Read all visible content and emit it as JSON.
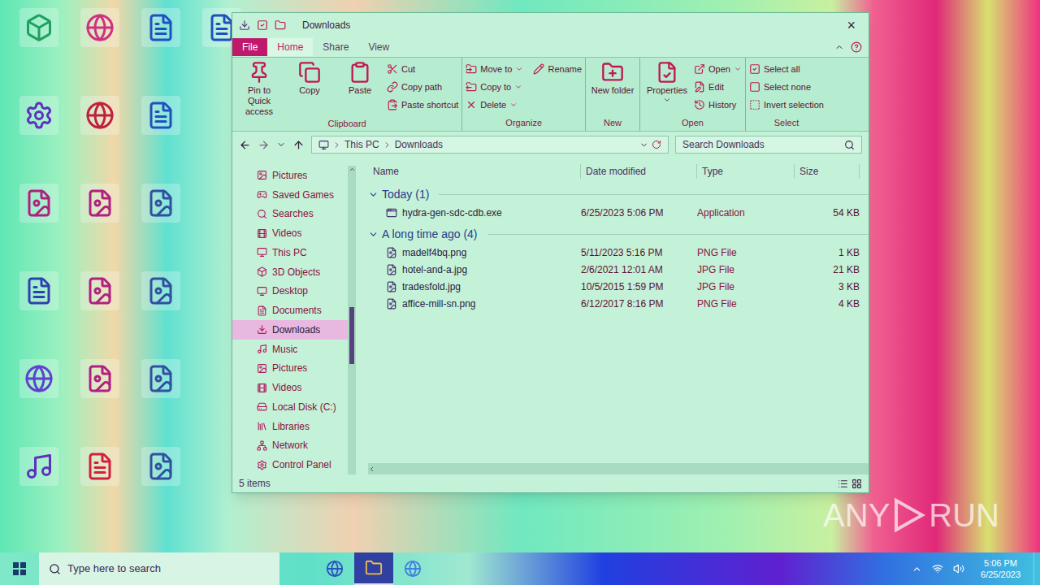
{
  "window": {
    "title": "Downloads",
    "close": "×"
  },
  "ribbon_tabs": [
    {
      "label": "File",
      "kind": "file",
      "selected": false
    },
    {
      "label": "Home",
      "kind": "tab",
      "selected": true
    },
    {
      "label": "Share",
      "kind": "tab",
      "selected": false
    },
    {
      "label": "View",
      "kind": "tab",
      "selected": false
    }
  ],
  "ribbon_groups": [
    {
      "label": "Clipboard",
      "items": [
        {
          "label": "Pin to Quick access",
          "kind": "large",
          "dropdown": false
        },
        {
          "label": "Copy",
          "kind": "large",
          "dropdown": false
        },
        {
          "label": "Paste",
          "kind": "large",
          "dropdown": false
        },
        {
          "label": "Cut",
          "kind": "small",
          "dropdown": false
        },
        {
          "label": "Copy path",
          "kind": "small",
          "dropdown": false
        },
        {
          "label": "Paste shortcut",
          "kind": "small",
          "dropdown": false
        }
      ]
    },
    {
      "label": "Organize",
      "items": [
        {
          "label": "Move to",
          "kind": "small",
          "dropdown": true
        },
        {
          "label": "Copy to",
          "kind": "small",
          "dropdown": true
        },
        {
          "label": "Delete",
          "kind": "small",
          "dropdown": true
        },
        {
          "label": "Rename",
          "kind": "small",
          "dropdown": false
        }
      ]
    },
    {
      "label": "New",
      "items": [
        {
          "label": "New folder",
          "kind": "large",
          "dropdown": false
        }
      ]
    },
    {
      "label": "Open",
      "items": [
        {
          "label": "Properties",
          "kind": "large",
          "dropdown": true
        },
        {
          "label": "Open",
          "kind": "small",
          "dropdown": true
        },
        {
          "label": "Edit",
          "kind": "small",
          "dropdown": false
        },
        {
          "label": "History",
          "kind": "small",
          "dropdown": false
        }
      ]
    },
    {
      "label": "Select",
      "items": [
        {
          "label": "Select all",
          "kind": "small",
          "dropdown": false
        },
        {
          "label": "Select none",
          "kind": "small",
          "dropdown": false
        },
        {
          "label": "Invert selection",
          "kind": "small",
          "dropdown": false
        }
      ]
    }
  ],
  "address": {
    "parts": [
      "This PC",
      "Downloads"
    ]
  },
  "search": {
    "placeholder": "Search Downloads"
  },
  "nav": [
    {
      "label": "Pictures",
      "selected": false
    },
    {
      "label": "Saved Games",
      "selected": false
    },
    {
      "label": "Searches",
      "selected": false
    },
    {
      "label": "Videos",
      "selected": false
    },
    {
      "label": "This PC",
      "selected": false
    },
    {
      "label": "3D Objects",
      "selected": false
    },
    {
      "label": "Desktop",
      "selected": false
    },
    {
      "label": "Documents",
      "selected": false
    },
    {
      "label": "Downloads",
      "selected": true
    },
    {
      "label": "Music",
      "selected": false
    },
    {
      "label": "Pictures",
      "selected": false
    },
    {
      "label": "Videos",
      "selected": false
    },
    {
      "label": "Local Disk (C:)",
      "selected": false
    },
    {
      "label": "Libraries",
      "selected": false
    },
    {
      "label": "Network",
      "selected": false
    },
    {
      "label": "Control Panel",
      "selected": false
    }
  ],
  "columns": [
    "Name",
    "Date modified",
    "Type",
    "Size"
  ],
  "groups": [
    {
      "label": "Today (1)",
      "expanded": true,
      "files": [
        {
          "name": "hydra-gen-sdc-cdb.exe",
          "date": "6/25/2023 5:06 PM",
          "type": "Application",
          "size": "54 KB",
          "kind": "app"
        }
      ]
    },
    {
      "label": "A long time ago (4)",
      "expanded": true,
      "files": [
        {
          "name": "madelf4bq.png",
          "date": "5/11/2023 5:16 PM",
          "type": "PNG File",
          "size": "1 KB",
          "kind": "image"
        },
        {
          "name": "hotel-and-a.jpg",
          "date": "2/6/2021 12:01 AM",
          "type": "JPG File",
          "size": "21 KB",
          "kind": "image"
        },
        {
          "name": "tradesfold.jpg",
          "date": "10/5/2015 1:59 PM",
          "type": "JPG File",
          "size": "3 KB",
          "kind": "image"
        },
        {
          "name": "affice-mill-sn.png",
          "date": "6/12/2017 8:16 PM",
          "type": "PNG File",
          "size": "4 KB",
          "kind": "image"
        }
      ]
    }
  ],
  "status_bar": {
    "count": "5 items"
  },
  "taskbar": {
    "search_placeholder": "Type here to search",
    "time": "5:06 PM",
    "date": "6/25/2023"
  },
  "watermark": {
    "left": "ANY",
    "right": "RUN"
  }
}
